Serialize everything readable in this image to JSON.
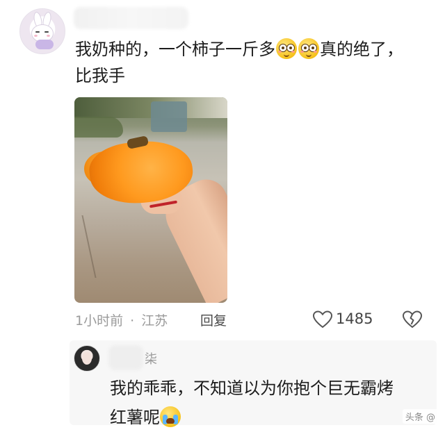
{
  "comment": {
    "text_line1_a": "我奶种的，一个柿子一斤多",
    "text_line1_b": "真的绝了，",
    "text_line2": "比我手",
    "emoji_1": "wide-eyed-face-emoji",
    "emoji_2": "wide-eyed-face-emoji",
    "time": "1小时前",
    "separator": "·",
    "location": "江苏",
    "reply_label": "回复",
    "like_count": "1485"
  },
  "reply": {
    "name_fragment": "柒",
    "text_line1": "我的乖乖，不知道以为你抱个巨无霸烤",
    "text_line2": "红薯呢",
    "emoji": "crying-face-emoji"
  },
  "watermark": "头条 @",
  "colors": {
    "meta_gray": "#9a9a9a",
    "text_dark": "#1c1c1c",
    "persimmon_orange": "#f08a12"
  }
}
